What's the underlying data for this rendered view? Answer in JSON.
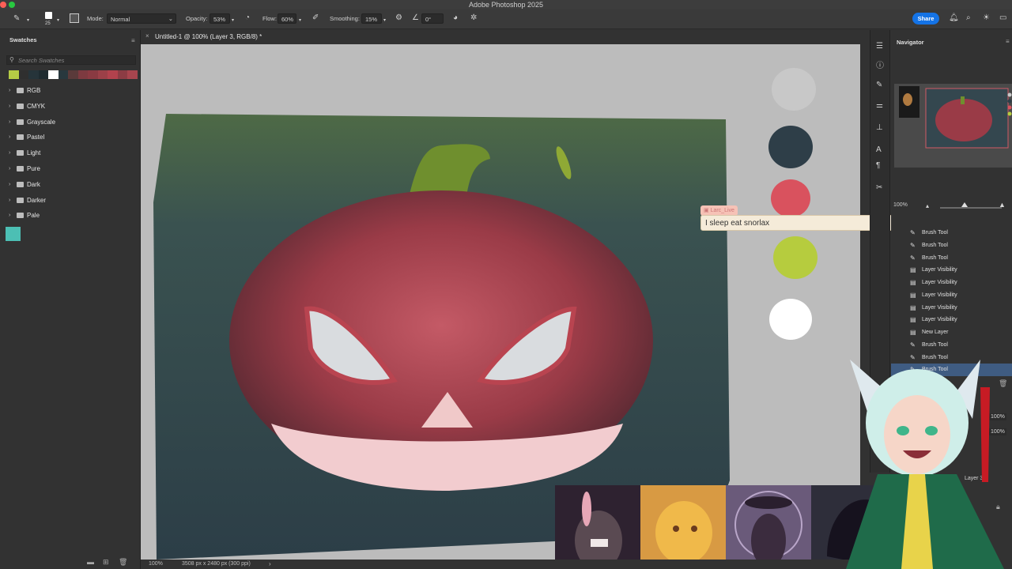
{
  "window": {
    "title": "Adobe Photoshop 2025"
  },
  "options_bar": {
    "brush_size": "25",
    "mode_label": "Mode:",
    "mode_value": "Normal",
    "opacity_label": "Opacity:",
    "opacity_value": "53%",
    "flow_label": "Flow:",
    "flow_value": "60%",
    "smoothing_label": "Smoothing:",
    "smoothing_value": "15%",
    "angle_value": "0°",
    "share_label": "Share"
  },
  "swatches_panel": {
    "title": "Swatches",
    "search_placeholder": "Search Swatches",
    "recent_colors": [
      "#b5cc45",
      "#2f2f2f",
      "#26343a",
      "#1e2b30",
      "#ffffff",
      "#28383e",
      "#5a3a3a",
      "#7d3a40",
      "#8a3a42",
      "#9c4048",
      "#b2424d",
      "#8c3c44",
      "#a8454e"
    ],
    "groups": [
      "RGB",
      "CMYK",
      "Grayscale",
      "Pastel",
      "Light",
      "Pure",
      "Dark",
      "Darker",
      "Pale"
    ],
    "extra_swatch": "#4cbfb4"
  },
  "document": {
    "tab_title": "Untitled-1 @ 100% (Layer 3, RGB/8) *",
    "zoom": "100%",
    "dimensions": "3508 px x 2480 px (300 ppi)"
  },
  "palette_circles": [
    "#c8c8c8",
    "#2e3e48",
    "#d9525e",
    "#b6cc3e",
    "#ffffff"
  ],
  "navigator": {
    "title": "Navigator",
    "zoom": "100%"
  },
  "history": [
    {
      "label": "Brush Tool",
      "icon": "brush"
    },
    {
      "label": "Brush Tool",
      "icon": "brush"
    },
    {
      "label": "Brush Tool",
      "icon": "brush"
    },
    {
      "label": "Layer Visibility",
      "icon": "doc"
    },
    {
      "label": "Layer Visibility",
      "icon": "doc"
    },
    {
      "label": "Layer Visibility",
      "icon": "doc"
    },
    {
      "label": "Layer Visibility",
      "icon": "doc"
    },
    {
      "label": "Layer Visibility",
      "icon": "doc"
    },
    {
      "label": "New Layer",
      "icon": "doc"
    },
    {
      "label": "Brush Tool",
      "icon": "brush"
    },
    {
      "label": "Brush Tool",
      "icon": "brush"
    },
    {
      "label": "Brush Tool",
      "icon": "brush"
    }
  ],
  "layers_panel": {
    "opacity": "100%",
    "fill": "100%",
    "layer_name": "Layer 3"
  },
  "chat": {
    "username": "Larc_Live",
    "message": "I sleep eat snorlax"
  }
}
